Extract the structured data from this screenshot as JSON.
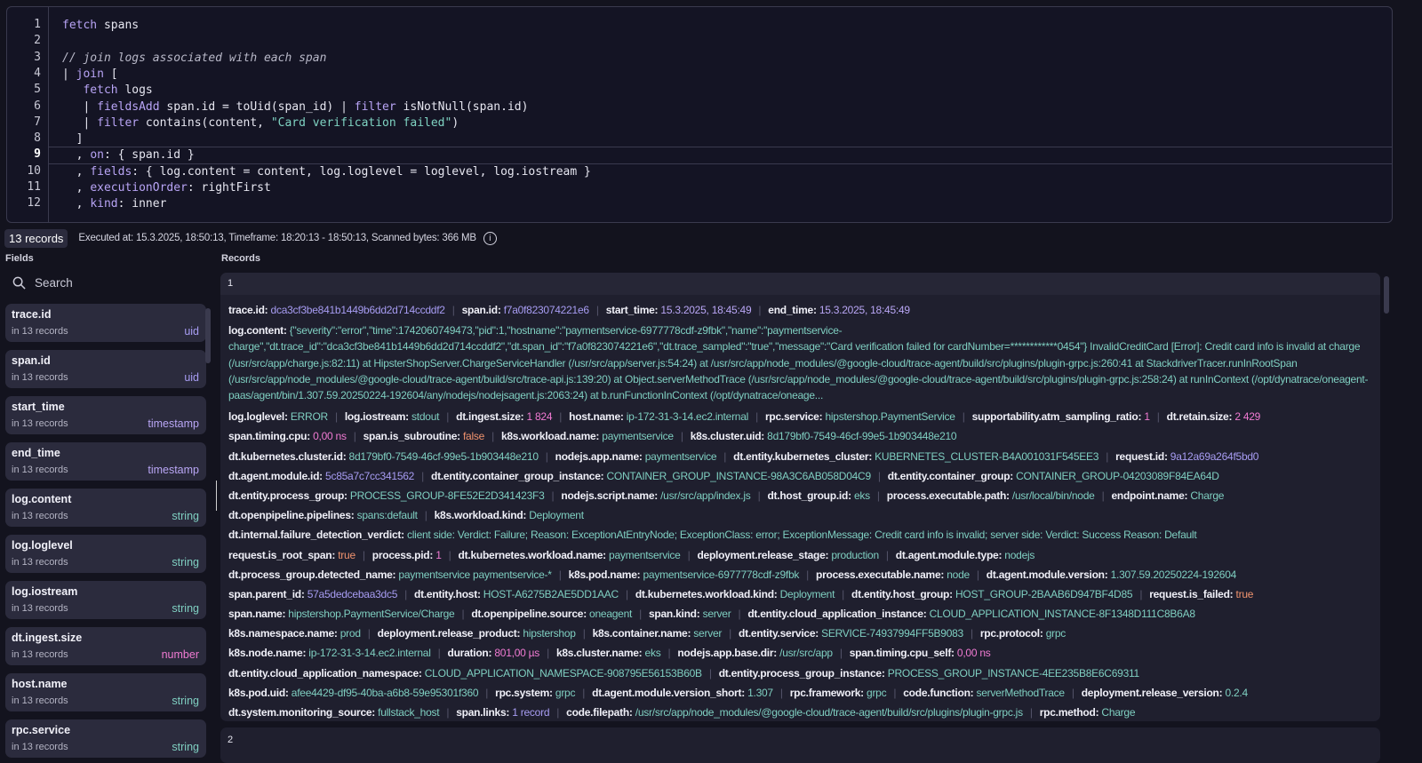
{
  "editor": {
    "lines": [
      [
        {
          "t": "kw",
          "v": "fetch"
        },
        {
          "t": "",
          "v": " spans"
        }
      ],
      [],
      [
        {
          "t": "cm",
          "v": "// join logs associated with each span"
        }
      ],
      [
        {
          "t": "",
          "v": "| "
        },
        {
          "t": "kw",
          "v": "join"
        },
        {
          "t": "",
          "v": " ["
        }
      ],
      [
        {
          "t": "",
          "v": "   "
        },
        {
          "t": "kw",
          "v": "fetch"
        },
        {
          "t": "",
          "v": " logs"
        }
      ],
      [
        {
          "t": "",
          "v": "   | "
        },
        {
          "t": "kw",
          "v": "fieldsAdd"
        },
        {
          "t": "",
          "v": " span.id = toUid(span_id) | "
        },
        {
          "t": "kw",
          "v": "filter"
        },
        {
          "t": "",
          "v": " isNotNull(span.id)"
        }
      ],
      [
        {
          "t": "",
          "v": "   | "
        },
        {
          "t": "kw",
          "v": "filter"
        },
        {
          "t": "",
          "v": " contains(content, "
        },
        {
          "t": "str",
          "v": "\"Card verification failed\""
        },
        {
          "t": "",
          "v": ")"
        }
      ],
      [
        {
          "t": "",
          "v": "  ]"
        }
      ],
      [
        {
          "t": "",
          "v": "  , "
        },
        {
          "t": "kw",
          "v": "on"
        },
        {
          "t": "",
          "v": ": { span.id }"
        }
      ],
      [
        {
          "t": "",
          "v": "  , "
        },
        {
          "t": "kw",
          "v": "fields"
        },
        {
          "t": "",
          "v": ": { log.content = content, log.loglevel = loglevel, log.iostream }"
        }
      ],
      [
        {
          "t": "",
          "v": "  , "
        },
        {
          "t": "kw",
          "v": "executionOrder"
        },
        {
          "t": "",
          "v": ": rightFirst"
        }
      ],
      [
        {
          "t": "",
          "v": "  , "
        },
        {
          "t": "kw",
          "v": "kind"
        },
        {
          "t": "",
          "v": ": inner"
        }
      ]
    ],
    "active_line": 9
  },
  "status": {
    "records_badge": "13 records",
    "executed": "Executed at: 15.3.2025, 18:50:13, Timeframe: 18:20:13 - 18:50:13, Scanned bytes: 366 MB",
    "info_icon": "i"
  },
  "labels": {
    "fields": "Fields",
    "records": "Records"
  },
  "search": {
    "placeholder": "Search"
  },
  "colors": {
    "string": "#7fcfc1",
    "uid": "#a79cf2",
    "timestamp": "#b9a6f5",
    "number": "#f07ad2",
    "boolean": "#f0936e"
  },
  "fields": [
    {
      "name": "trace.id",
      "count": "in 13 records",
      "type": "uid"
    },
    {
      "name": "span.id",
      "count": "in 13 records",
      "type": "uid"
    },
    {
      "name": "start_time",
      "count": "in 13 records",
      "type": "timestamp"
    },
    {
      "name": "end_time",
      "count": "in 13 records",
      "type": "timestamp"
    },
    {
      "name": "log.content",
      "count": "in 13 records",
      "type": "string"
    },
    {
      "name": "log.loglevel",
      "count": "in 13 records",
      "type": "string"
    },
    {
      "name": "log.iostream",
      "count": "in 13 records",
      "type": "string"
    },
    {
      "name": "dt.ingest.size",
      "count": "in 13 records",
      "type": "number"
    },
    {
      "name": "host.name",
      "count": "in 13 records",
      "type": "string"
    },
    {
      "name": "rpc.service",
      "count": "in 13 records",
      "type": "string"
    }
  ],
  "record": {
    "index": "1",
    "lines": [
      [
        {
          "k": "trace.id:",
          "v": "dca3cf3be841b1449b6dd2d714ccddf2",
          "t": "id"
        },
        {
          "k": "span.id:",
          "v": "f7a0f823074221e6",
          "t": "id"
        },
        {
          "k": "start_time:",
          "v": "15.3.2025, 18:45:49",
          "t": "time"
        },
        {
          "k": "end_time:",
          "v": "15.3.2025, 18:45:49",
          "t": "time"
        }
      ],
      [
        {
          "k": "log.content:",
          "v": "{\"severity\":\"error\",\"time\":1742060749473,\"pid\":1,\"hostname\":\"paymentservice-6977778cdf-z9fbk\",\"name\":\"paymentservice-charge\",\"dt.trace_id\":\"dca3cf3be841b1449b6dd2d714ccddf2\",\"dt.span_id\":\"f7a0f823074221e6\",\"dt.trace_sampled\":\"true\",\"message\":\"Card verification failed for cardNumber=************0454\"} InvalidCreditCard [Error]: Credit card info is invalid at charge (/usr/src/app/charge.js:82:11) at HipsterShopServer.ChargeServiceHandler (/usr/src/app/server.js:54:24) at /usr/src/app/node_modules/@google-cloud/trace-agent/build/src/plugins/plugin-grpc.js:260:41 at StackdriverTracer.runInRootSpan (/usr/src/app/node_modules/@google-cloud/trace-agent/build/src/trace-api.js:139:20) at Object.serverMethodTrace (/usr/src/app/node_modules/@google-cloud/trace-agent/build/src/plugins/plugin-grpc.js:258:24) at runInContext (/opt/dynatrace/oneagent-paas/agent/bin/1.307.59.20250224-192604/any/nodejs/nodejsagent.js:2063:24) at b.runFunctionInContext (/opt/dynatrace/oneage...",
          "t": "string"
        }
      ],
      [
        {
          "k": "log.loglevel:",
          "v": "ERROR",
          "t": "string"
        },
        {
          "k": "log.iostream:",
          "v": "stdout",
          "t": "string"
        },
        {
          "k": "dt.ingest.size:",
          "v": "1 824",
          "t": "number"
        },
        {
          "k": "host.name:",
          "v": "ip-172-31-3-14.ec2.internal",
          "t": "string"
        },
        {
          "k": "rpc.service:",
          "v": "hipstershop.PaymentService",
          "t": "string"
        },
        {
          "k": "supportability.atm_sampling_ratio:",
          "v": "1",
          "t": "number"
        },
        {
          "k": "dt.retain.size:",
          "v": "2 429",
          "t": "number"
        }
      ],
      [
        {
          "k": "span.timing.cpu:",
          "v": "0,00 ns",
          "t": "number"
        },
        {
          "k": "span.is_subroutine:",
          "v": "false",
          "t": "bool"
        },
        {
          "k": "k8s.workload.name:",
          "v": "paymentservice",
          "t": "string"
        },
        {
          "k": "k8s.cluster.uid:",
          "v": "8d179bf0-7549-46cf-99e5-1b903448e210",
          "t": "string"
        }
      ],
      [
        {
          "k": "dt.kubernetes.cluster.id:",
          "v": "8d179bf0-7549-46cf-99e5-1b903448e210",
          "t": "string"
        },
        {
          "k": "nodejs.app.name:",
          "v": "paymentservice",
          "t": "string"
        },
        {
          "k": "dt.entity.kubernetes_cluster:",
          "v": "KUBERNETES_CLUSTER-B4A001031F545EE3",
          "t": "string"
        },
        {
          "k": "request.id:",
          "v": "9a12a69a264f5bd0",
          "t": "id"
        }
      ],
      [
        {
          "k": "dt.agent.module.id:",
          "v": "5c85a7c7cc341562",
          "t": "id"
        },
        {
          "k": "dt.entity.container_group_instance:",
          "v": "CONTAINER_GROUP_INSTANCE-98A3C6AB058D04C9",
          "t": "string"
        },
        {
          "k": "dt.entity.container_group:",
          "v": "CONTAINER_GROUP-04203089F84EA64D",
          "t": "string"
        }
      ],
      [
        {
          "k": "dt.entity.process_group:",
          "v": "PROCESS_GROUP-8FE52E2D341423F3",
          "t": "string"
        },
        {
          "k": "nodejs.script.name:",
          "v": "/usr/src/app/index.js",
          "t": "string"
        },
        {
          "k": "dt.host_group.id:",
          "v": "eks",
          "t": "string"
        },
        {
          "k": "process.executable.path:",
          "v": "/usr/local/bin/node",
          "t": "string"
        },
        {
          "k": "endpoint.name:",
          "v": "Charge",
          "t": "string"
        }
      ],
      [
        {
          "k": "dt.openpipeline.pipelines:",
          "v": "spans:default",
          "t": "string"
        },
        {
          "k": "k8s.workload.kind:",
          "v": "Deployment",
          "t": "string"
        }
      ],
      [
        {
          "k": "dt.internal.failure_detection_verdict:",
          "v": "client side: Verdict: Failure; Reason: ExceptionAtEntryNode; ExceptionClass: error; ExceptionMessage: Credit card info is invalid; server side: Verdict: Success Reason: Default",
          "t": "string"
        }
      ],
      [
        {
          "k": "request.is_root_span:",
          "v": "true",
          "t": "bool"
        },
        {
          "k": "process.pid:",
          "v": "1",
          "t": "number"
        },
        {
          "k": "dt.kubernetes.workload.name:",
          "v": "paymentservice",
          "t": "string"
        },
        {
          "k": "deployment.release_stage:",
          "v": "production",
          "t": "string"
        },
        {
          "k": "dt.agent.module.type:",
          "v": "nodejs",
          "t": "string"
        }
      ],
      [
        {
          "k": "dt.process_group.detected_name:",
          "v": "paymentservice paymentservice-*",
          "t": "string"
        },
        {
          "k": "k8s.pod.name:",
          "v": "paymentservice-6977778cdf-z9fbk",
          "t": "string"
        },
        {
          "k": "process.executable.name:",
          "v": "node",
          "t": "string"
        },
        {
          "k": "dt.agent.module.version:",
          "v": "1.307.59.20250224-192604",
          "t": "string"
        }
      ],
      [
        {
          "k": "span.parent_id:",
          "v": "57a5dedcebaa3dc5",
          "t": "id"
        },
        {
          "k": "dt.entity.host:",
          "v": "HOST-A6275B2AE5DD1AAC",
          "t": "string"
        },
        {
          "k": "dt.kubernetes.workload.kind:",
          "v": "Deployment",
          "t": "string"
        },
        {
          "k": "dt.entity.host_group:",
          "v": "HOST_GROUP-2BAAB6D947BF4D85",
          "t": "string"
        },
        {
          "k": "request.is_failed:",
          "v": "true",
          "t": "bool"
        }
      ],
      [
        {
          "k": "span.name:",
          "v": "hipstershop.PaymentService/Charge",
          "t": "string"
        },
        {
          "k": "dt.openpipeline.source:",
          "v": "oneagent",
          "t": "string"
        },
        {
          "k": "span.kind:",
          "v": "server",
          "t": "string"
        },
        {
          "k": "dt.entity.cloud_application_instance:",
          "v": "CLOUD_APPLICATION_INSTANCE-8F1348D111C8B6A8",
          "t": "string"
        }
      ],
      [
        {
          "k": "k8s.namespace.name:",
          "v": "prod",
          "t": "string"
        },
        {
          "k": "deployment.release_product:",
          "v": "hipstershop",
          "t": "string"
        },
        {
          "k": "k8s.container.name:",
          "v": "server",
          "t": "string"
        },
        {
          "k": "dt.entity.service:",
          "v": "SERVICE-74937994FF5B9083",
          "t": "string"
        },
        {
          "k": "rpc.protocol:",
          "v": "grpc",
          "t": "string"
        }
      ],
      [
        {
          "k": "k8s.node.name:",
          "v": "ip-172-31-3-14.ec2.internal",
          "t": "string"
        },
        {
          "k": "duration:",
          "v": "801,00 µs",
          "t": "number"
        },
        {
          "k": "k8s.cluster.name:",
          "v": "eks",
          "t": "string"
        },
        {
          "k": "nodejs.app.base.dir:",
          "v": "/usr/src/app",
          "t": "string"
        },
        {
          "k": "span.timing.cpu_self:",
          "v": "0,00 ns",
          "t": "number"
        }
      ],
      [
        {
          "k": "dt.entity.cloud_application_namespace:",
          "v": "CLOUD_APPLICATION_NAMESPACE-908795E56153B60B",
          "t": "string"
        },
        {
          "k": "dt.entity.process_group_instance:",
          "v": "PROCESS_GROUP_INSTANCE-4EE235B8E6C69311",
          "t": "string"
        }
      ],
      [
        {
          "k": "k8s.pod.uid:",
          "v": "afee4429-df95-40ba-a6b8-59e95301f360",
          "t": "string"
        },
        {
          "k": "rpc.system:",
          "v": "grpc",
          "t": "string"
        },
        {
          "k": "dt.agent.module.version_short:",
          "v": "1.307",
          "t": "string"
        },
        {
          "k": "rpc.framework:",
          "v": "grpc",
          "t": "string"
        },
        {
          "k": "code.function:",
          "v": "serverMethodTrace",
          "t": "string"
        },
        {
          "k": "deployment.release_version:",
          "v": "0.2.4",
          "t": "string"
        }
      ],
      [
        {
          "k": "dt.system.monitoring_source:",
          "v": "fullstack_host",
          "t": "string"
        },
        {
          "k": "span.links:",
          "v": "1 record",
          "t": "id"
        },
        {
          "k": "code.filepath:",
          "v": "/usr/src/app/node_modules/@google-cloud/trace-agent/build/src/plugins/plugin-grpc.js",
          "t": "string"
        },
        {
          "k": "rpc.method:",
          "v": "Charge",
          "t": "string"
        }
      ]
    ]
  },
  "next_record": {
    "index": "2"
  }
}
